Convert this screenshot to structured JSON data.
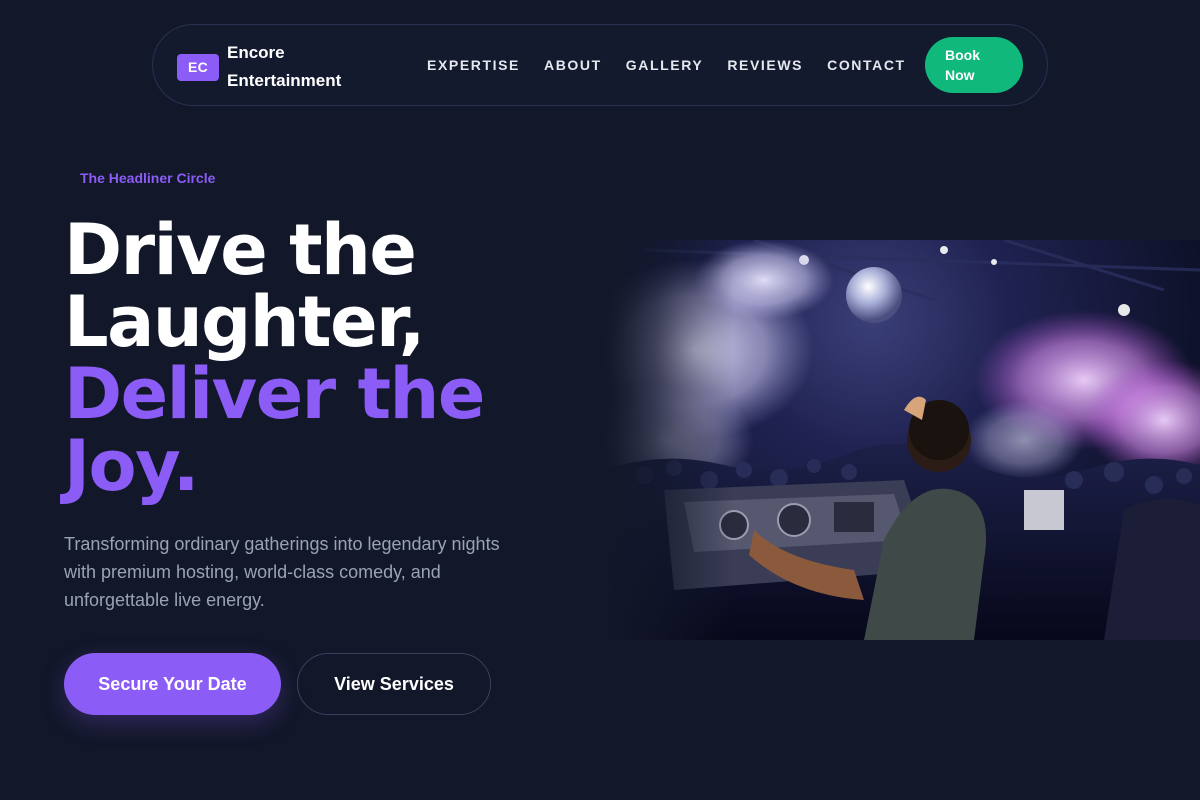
{
  "brand": {
    "badge": "EC",
    "name_line1": "Encore",
    "name_line2": "Entertainment"
  },
  "nav": {
    "links": [
      "EXPERTISE",
      "ABOUT",
      "GALLERY",
      "REVIEWS",
      "CONTACT"
    ],
    "book_line1": "Book",
    "book_line2": "Now"
  },
  "hero": {
    "eyebrow": "The Headliner Circle",
    "headline_line1": "Drive the",
    "headline_line2": "Laughter,",
    "headline_line3": "Deliver the",
    "headline_line4": "Joy.",
    "subtext": "Transforming ordinary gatherings into legendary nights with premium hosting, world-class comedy, and unforgettable live energy.",
    "cta_primary": "Secure Your Date",
    "cta_secondary": "View Services",
    "image_icon": "dj-party-photo"
  },
  "colors": {
    "background": "#121729",
    "accent_purple": "#8b5cf6",
    "accent_green": "#10b97b",
    "muted_text": "#9aa3b6"
  }
}
